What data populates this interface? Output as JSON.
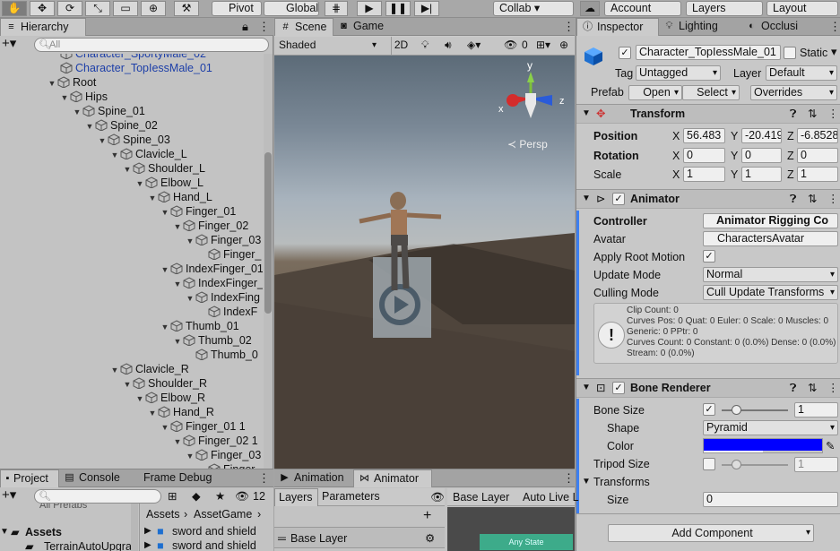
{
  "toolbar": {
    "pivot": "Pivot",
    "global": "Global",
    "collab": "Collab ▾",
    "account": "Account",
    "layers": "Layers",
    "layout": "Layout"
  },
  "hierarchy": {
    "tab": "Hierarchy",
    "search_placeholder": "All",
    "rows": [
      {
        "label": "Character_SportyMale_02",
        "depth": 0,
        "arrow": "",
        "blue": true
      },
      {
        "label": "Character_TopIessMale_01",
        "depth": 0,
        "arrow": "",
        "blue": true
      },
      {
        "label": "Root",
        "depth": 0,
        "arrow": "▼"
      },
      {
        "label": "Hips",
        "depth": 1,
        "arrow": "▼"
      },
      {
        "label": "Spine_01",
        "depth": 2,
        "arrow": "▼"
      },
      {
        "label": "Spine_02",
        "depth": 3,
        "arrow": "▼"
      },
      {
        "label": "Spine_03",
        "depth": 4,
        "arrow": "▼"
      },
      {
        "label": "Clavicle_L",
        "depth": 5,
        "arrow": "▼"
      },
      {
        "label": "Shoulder_L",
        "depth": 6,
        "arrow": "▼"
      },
      {
        "label": "Elbow_L",
        "depth": 7,
        "arrow": "▼"
      },
      {
        "label": "Hand_L",
        "depth": 8,
        "arrow": "▼"
      },
      {
        "label": "Finger_01",
        "depth": 9,
        "arrow": "▼"
      },
      {
        "label": "Finger_02",
        "depth": 10,
        "arrow": "▼"
      },
      {
        "label": "Finger_03",
        "depth": 11,
        "arrow": "▼"
      },
      {
        "label": "Finger_",
        "depth": 12,
        "arrow": ""
      },
      {
        "label": "IndexFinger_01",
        "depth": 9,
        "arrow": "▼"
      },
      {
        "label": "IndexFinger_",
        "depth": 10,
        "arrow": "▼"
      },
      {
        "label": "IndexFing",
        "depth": 11,
        "arrow": "▼"
      },
      {
        "label": "IndexF",
        "depth": 12,
        "arrow": ""
      },
      {
        "label": "Thumb_01",
        "depth": 9,
        "arrow": "▼"
      },
      {
        "label": "Thumb_02",
        "depth": 10,
        "arrow": "▼"
      },
      {
        "label": "Thumb_0",
        "depth": 11,
        "arrow": ""
      },
      {
        "label": "Clavicle_R",
        "depth": 5,
        "arrow": "▼"
      },
      {
        "label": "Shoulder_R",
        "depth": 6,
        "arrow": "▼"
      },
      {
        "label": "Elbow_R",
        "depth": 7,
        "arrow": "▼"
      },
      {
        "label": "Hand_R",
        "depth": 8,
        "arrow": "▼"
      },
      {
        "label": "Finger_01 1",
        "depth": 9,
        "arrow": "▼"
      },
      {
        "label": "Finger_02 1",
        "depth": 10,
        "arrow": "▼"
      },
      {
        "label": "Finger_03",
        "depth": 11,
        "arrow": "▼"
      },
      {
        "label": "Finger_",
        "depth": 12,
        "arrow": ""
      }
    ]
  },
  "scene": {
    "tab_scene": "Scene",
    "tab_game": "Game",
    "shading": "Shaded",
    "mode_2d": "2D",
    "hidden_count": "0",
    "persp": "≺ Persp",
    "gizmo_y": "y",
    "gizmo_x": "x",
    "gizmo_z": "z"
  },
  "inspector": {
    "tab": "Inspector",
    "tab_lighting": "Lighting",
    "tab_occlusion": "Occlusi",
    "name": "Character_TopIessMale_01",
    "static": "Static",
    "tag_label": "Tag",
    "tag": "Untagged",
    "layer_label": "Layer",
    "layer": "Default",
    "prefab_label": "Prefab",
    "open": "Open",
    "select": "Select",
    "overrides": "Overrides",
    "transform": {
      "title": "Transform",
      "position": "Position",
      "rotation": "Rotation",
      "scale": "Scale",
      "px": "56.483",
      "py": "-20.419",
      "pz": "-6.8528",
      "rx": "0",
      "ry": "0",
      "rz": "0",
      "sx": "1",
      "sy": "1",
      "sz": "1",
      "x": "X",
      "y": "Y",
      "z": "Z"
    },
    "animator": {
      "title": "Animator",
      "controller_label": "Controller",
      "controller": "Animator Rigging Co",
      "avatar_label": "Avatar",
      "avatar": "CharactersAvatar",
      "root_motion_label": "Apply Root Motion",
      "update_label": "Update Mode",
      "update": "Normal",
      "culling_label": "Culling Mode",
      "culling": "Cull Update Transforms",
      "info": "Clip Count: 0\nCurves Pos: 0 Quat: 0 Euler: 0 Scale: 0 Muscles: 0 Generic: 0 PPtr: 0\nCurves Count: 0 Constant: 0 (0.0%) Dense: 0 (0.0%) Stream: 0 (0.0%)"
    },
    "bone_renderer": {
      "title": "Bone Renderer",
      "size_label": "Bone Size",
      "size": "1",
      "shape_label": "Shape",
      "shape": "Pyramid",
      "color_label": "Color",
      "color": "#0000ff",
      "tripod_label": "Tripod Size",
      "tripod": "1",
      "transforms_label": "Transforms",
      "tsize_label": "Size",
      "tsize": "0"
    },
    "add_component": "Add Component"
  },
  "project": {
    "tab_project": "Project",
    "tab_console": "Console",
    "tab_frame": "Frame Debug",
    "count": "12",
    "partial": "All Prefabs",
    "assets": "Assets",
    "terrain": "_TerrainAutoUpgra",
    "path_a": "Assets",
    "path_b": "AssetGame",
    "item1": "sword and shield",
    "item2": "sword and shield"
  },
  "animator_panel": {
    "tab_anim": "Animation",
    "tab_animator": "Animator",
    "layers": "Layers",
    "parameters": "Parameters",
    "base_layer_crumb": "Base Layer",
    "auto_live": "Auto Live L",
    "base_layer": "Base Layer",
    "any_state": "Any State"
  }
}
